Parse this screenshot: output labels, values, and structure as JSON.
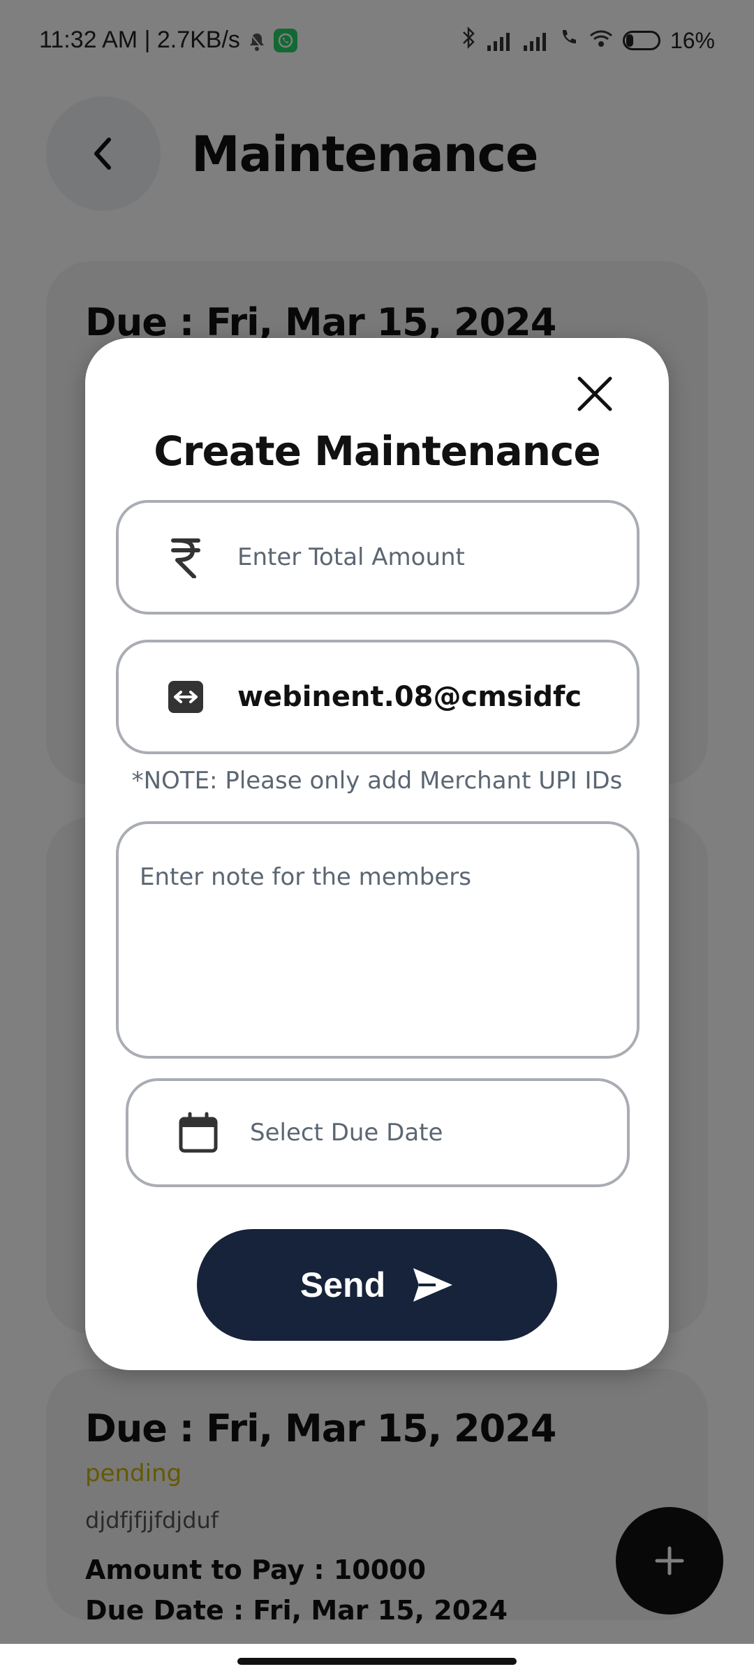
{
  "status_bar": {
    "time": "11:32 AM | 2.7KB/s",
    "battery": "16%"
  },
  "header": {
    "title": "Maintenance"
  },
  "cards": [
    {
      "due": "Due : Fri, Mar 15, 2024"
    },
    {
      "due": "Due : Fri, Mar 15, 2024",
      "status": "pending",
      "description": "djdfjfjjfdjduf",
      "amount": "Amount to Pay : 10000",
      "due_date": "Due Date : Fri, Mar 15, 2024"
    }
  ],
  "modal": {
    "title": "Create Maintenance",
    "amount_placeholder": "Enter Total Amount",
    "upi_value": "webinent.08@cmsidfc",
    "upi_note": "*NOTE: Please only add Merchant UPI IDs",
    "note_placeholder": "Enter note for the members",
    "date_placeholder": "Select Due Date",
    "send_label": "Send"
  },
  "colors": {
    "primary": "#16233a",
    "pending": "#c9b300",
    "overlay": "rgba(0,0,0,0.5)"
  },
  "icons": {
    "rupee": "rupee-icon",
    "upi": "upi-icon",
    "calendar": "calendar-icon",
    "send": "send-icon",
    "close": "close-icon",
    "back": "back-icon",
    "add": "plus-icon"
  }
}
